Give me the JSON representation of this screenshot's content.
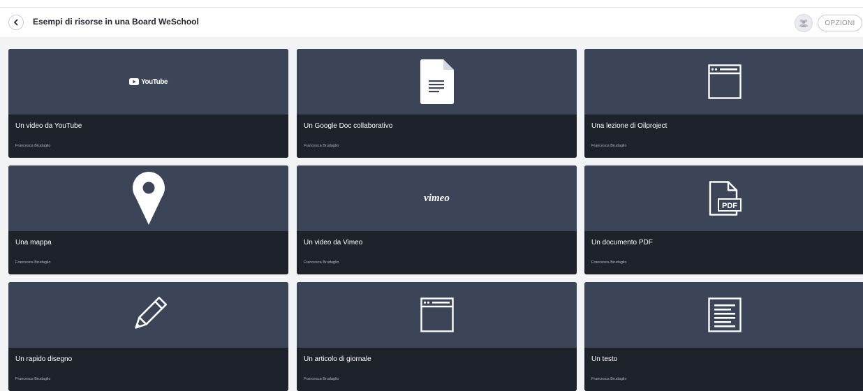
{
  "header": {
    "title": "Esempi di risorse in una Board WeSchool",
    "options_label": "OPZIONI"
  },
  "cards": [
    {
      "title": "Un video da YouTube",
      "author": "Francesca Brudaglio",
      "icon": "youtube-logo",
      "logo_text": "YouTube"
    },
    {
      "title": "Un Google Doc collaborativo",
      "author": "Francesca Brudaglio",
      "icon": "document-icon"
    },
    {
      "title": "Una lezione di Oilproject",
      "author": "Francesca Brudaglio",
      "icon": "browser-window-icon"
    },
    {
      "title": "Una mappa",
      "author": "Francesca Brudaglio",
      "icon": "map-pin-icon"
    },
    {
      "title": "Un video da Vimeo",
      "author": "Francesca Brudaglio",
      "icon": "vimeo-logo",
      "logo_text": "vimeo"
    },
    {
      "title": "Un documento PDF",
      "author": "Francesca Brudaglio",
      "icon": "pdf-file-icon",
      "badge_text": "PDF"
    },
    {
      "title": "Un rapido disegno",
      "author": "Francesca Brudaglio",
      "icon": "pencil-icon"
    },
    {
      "title": "Un articolo di giornale",
      "author": "Francesca Brudaglio",
      "icon": "browser-window-icon"
    },
    {
      "title": "Un testo",
      "author": "Francesca Brudaglio",
      "icon": "text-document-icon"
    }
  ],
  "colors": {
    "card_preview": "#3c4458",
    "card_meta": "#1e222b",
    "background": "#f2f3f5"
  }
}
